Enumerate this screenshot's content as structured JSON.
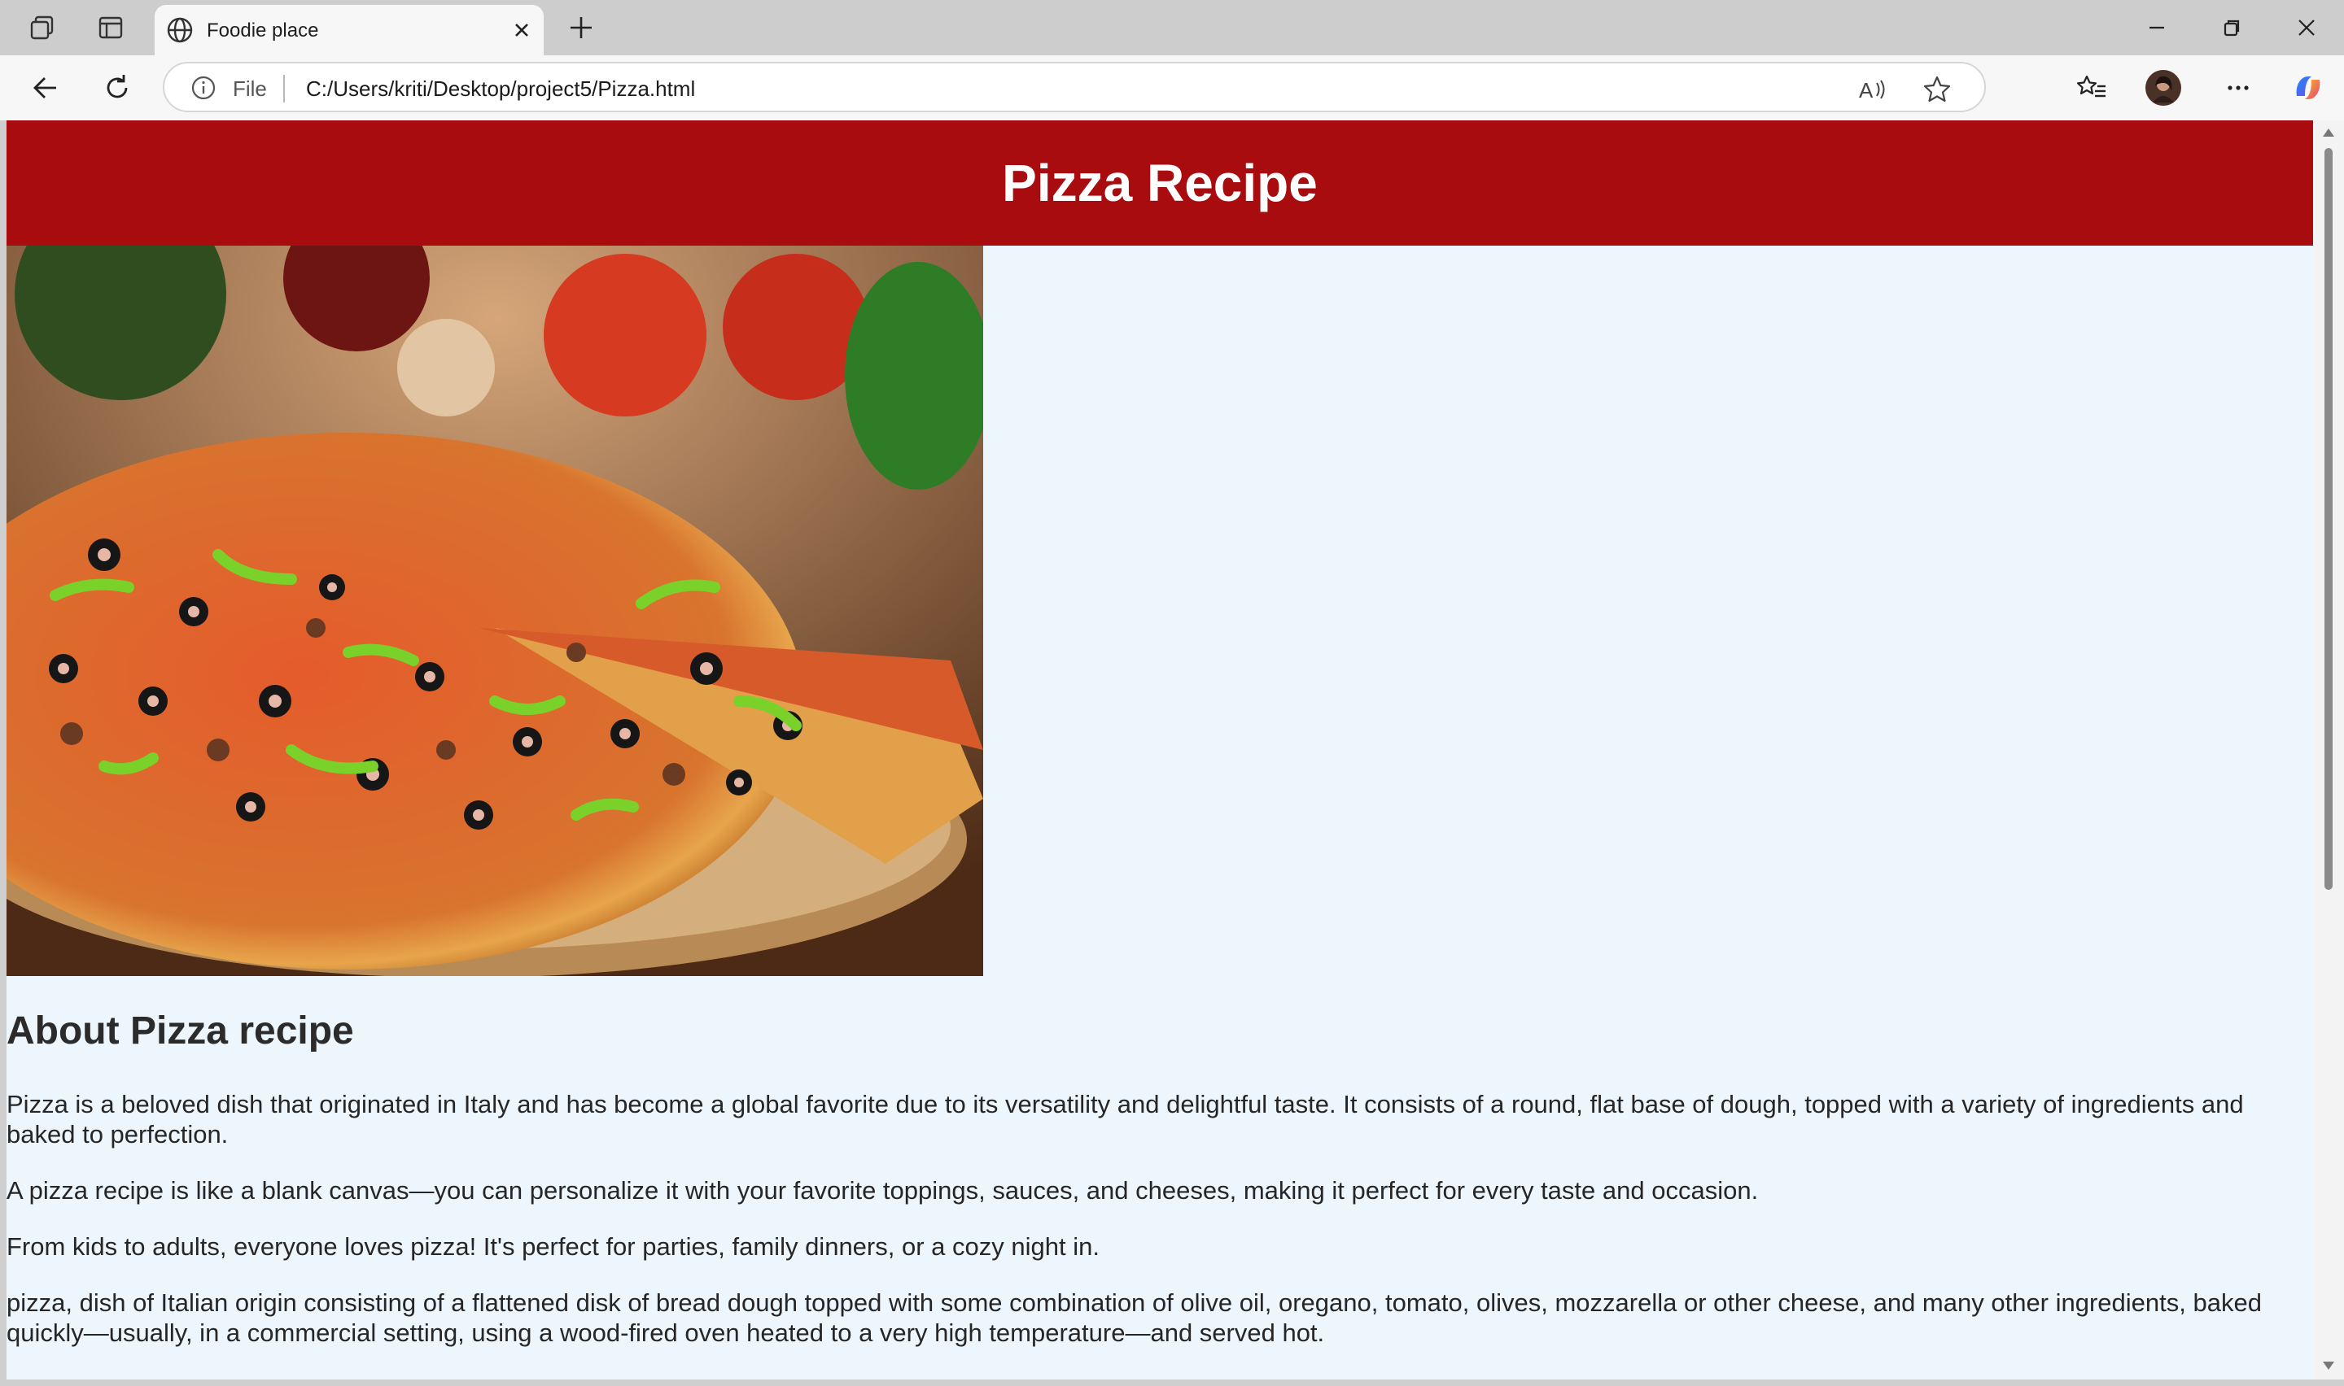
{
  "browser": {
    "tab_title": "Foodie place",
    "omnibox_label": "File",
    "url": "C:/Users/kriti/Desktop/project5/Pizza.html"
  },
  "page": {
    "header_title": "Pizza Recipe",
    "image_alt": "Pizza with olives, peppers and sausage",
    "section_heading": "About Pizza recipe",
    "paragraphs": [
      "Pizza is a beloved dish that originated in Italy and has become a global favorite due to its versatility and delightful taste. It consists of a round, flat base of dough, topped with a variety of ingredients and baked to perfection.",
      "A pizza recipe is like a blank canvas—you can personalize it with your favorite toppings, sauces, and cheeses, making it perfect for every taste and occasion.",
      "From kids to adults, everyone loves pizza! It's perfect for parties, family dinners, or a cozy night in.",
      "pizza, dish of Italian origin consisting of a flattened disk of bread dough topped with some combination of olive oil, oregano, tomato, olives, mozzarella or other cheese, and many other ingredients, baked quickly—usually, in a commercial setting, using a wood-fired oven heated to a very high temperature—and served hot."
    ]
  },
  "colors": {
    "header_bg": "#a80c0e",
    "page_bg": "#eef6fd",
    "tabstrip_bg": "#cdcdcd"
  },
  "icons": [
    "workspaces-icon",
    "vertical-tabs-icon",
    "globe-icon",
    "close-tab-icon",
    "new-tab-icon",
    "minimize-icon",
    "restore-icon",
    "close-window-icon",
    "back-icon",
    "refresh-icon",
    "info-icon",
    "read-aloud-icon",
    "favorite-star-icon",
    "favorites-icon",
    "profile-avatar",
    "more-icon",
    "copilot-icon"
  ]
}
